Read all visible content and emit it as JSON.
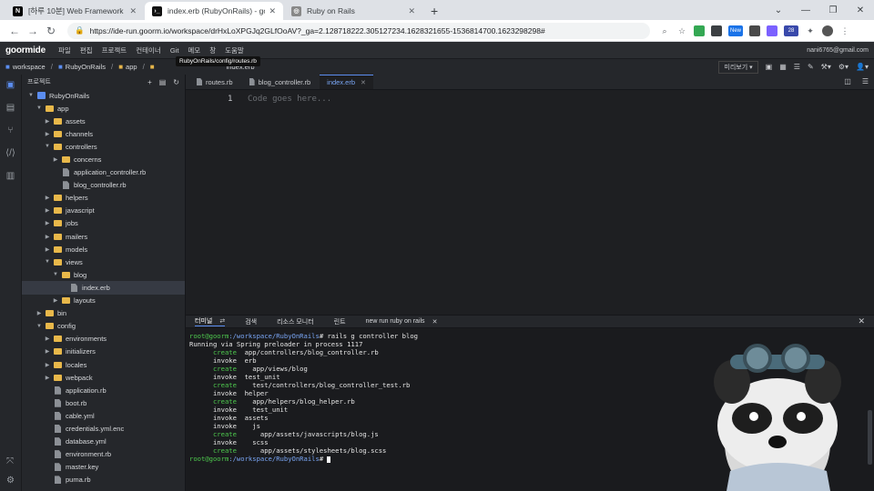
{
  "browser": {
    "tabs": [
      {
        "title": "[하루 10분] Web Framework : R",
        "favicon": "N",
        "favicon_color": "#000000",
        "active": false
      },
      {
        "title": "index.erb (RubyOnRails) - goorm",
        "favicon": "›_",
        "favicon_color": "#111111",
        "active": true
      },
      {
        "title": "Ruby on Rails",
        "favicon": "◎",
        "favicon_color": "#888888",
        "active": false
      }
    ],
    "new_tab": "+",
    "url": "https://ide-run.goorm.io/workspace/drHxLoXPGJq2GLfOoAV?_ga=2.128718222.305127234.1628321655-1536814700.1623298298#",
    "badge_new": "New",
    "badge_count": "28"
  },
  "ide": {
    "logo": "goormide",
    "menu": [
      "파일",
      "편집",
      "프로젝트",
      "컨테이너",
      "Git",
      "메모",
      "창",
      "도움말"
    ],
    "user": "nani6765@gmail.com",
    "breadcrumb": [
      "workspace",
      "RubyOnRails",
      "app",
      "",
      "index.erb"
    ],
    "tooltip": "RubyOnRails/config/routes.rb",
    "preview_label": "미리보기",
    "sidebar_title": "프로젝트",
    "tree": [
      {
        "label": "RubyOnRails",
        "type": "project",
        "depth": 0,
        "open": true
      },
      {
        "label": "app",
        "type": "folder",
        "depth": 1,
        "open": true
      },
      {
        "label": "assets",
        "type": "folder",
        "depth": 2,
        "open": false
      },
      {
        "label": "channels",
        "type": "folder",
        "depth": 2,
        "open": false
      },
      {
        "label": "controllers",
        "type": "folder",
        "depth": 2,
        "open": true
      },
      {
        "label": "concerns",
        "type": "folder",
        "depth": 3,
        "open": false
      },
      {
        "label": "application_controller.rb",
        "type": "file",
        "depth": 3
      },
      {
        "label": "blog_controller.rb",
        "type": "file",
        "depth": 3
      },
      {
        "label": "helpers",
        "type": "folder",
        "depth": 2,
        "open": false
      },
      {
        "label": "javascript",
        "type": "folder",
        "depth": 2,
        "open": false
      },
      {
        "label": "jobs",
        "type": "folder",
        "depth": 2,
        "open": false
      },
      {
        "label": "mailers",
        "type": "folder",
        "depth": 2,
        "open": false
      },
      {
        "label": "models",
        "type": "folder",
        "depth": 2,
        "open": false
      },
      {
        "label": "views",
        "type": "folder",
        "depth": 2,
        "open": true
      },
      {
        "label": "blog",
        "type": "folder",
        "depth": 3,
        "open": true
      },
      {
        "label": "index.erb",
        "type": "file",
        "depth": 4,
        "selected": true
      },
      {
        "label": "layouts",
        "type": "folder",
        "depth": 3,
        "open": false
      },
      {
        "label": "bin",
        "type": "folder",
        "depth": 1,
        "open": false
      },
      {
        "label": "config",
        "type": "folder",
        "depth": 1,
        "open": true
      },
      {
        "label": "environments",
        "type": "folder",
        "depth": 2,
        "open": false
      },
      {
        "label": "initializers",
        "type": "folder",
        "depth": 2,
        "open": false
      },
      {
        "label": "locales",
        "type": "folder",
        "depth": 2,
        "open": false
      },
      {
        "label": "webpack",
        "type": "folder",
        "depth": 2,
        "open": false
      },
      {
        "label": "application.rb",
        "type": "file",
        "depth": 2
      },
      {
        "label": "boot.rb",
        "type": "file",
        "depth": 2
      },
      {
        "label": "cable.yml",
        "type": "file",
        "depth": 2
      },
      {
        "label": "credentials.yml.enc",
        "type": "file",
        "depth": 2
      },
      {
        "label": "database.yml",
        "type": "file",
        "depth": 2
      },
      {
        "label": "environment.rb",
        "type": "file",
        "depth": 2
      },
      {
        "label": "master.key",
        "type": "file",
        "depth": 2
      },
      {
        "label": "puma.rb",
        "type": "file",
        "depth": 2
      }
    ],
    "editor_tabs": [
      {
        "label": "routes.rb",
        "active": false
      },
      {
        "label": "blog_controller.rb",
        "active": false
      },
      {
        "label": "index.erb",
        "active": true
      }
    ],
    "editor": {
      "line_number": "1",
      "placeholder": "Code goes here..."
    },
    "terminal_tabs": [
      {
        "label": "터미널",
        "active": true
      },
      {
        "label": "검색",
        "active": false
      },
      {
        "label": "리소스 모니터",
        "active": false
      },
      {
        "label": "린트",
        "active": false
      },
      {
        "label": "new run ruby on rails",
        "active": false
      }
    ],
    "terminal": {
      "prompt_user": "root@goorm",
      "prompt_path": ":/workspace/RubyOnRails",
      "command": "# rails g controller blog",
      "lines": [
        {
          "text": "Running via Spring preloader in process 1117",
          "action": "",
          "color": "plain"
        },
        {
          "action": "create",
          "text": "app/controllers/blog_controller.rb",
          "indent": "      "
        },
        {
          "action": "invoke",
          "text": "erb",
          "indent": "      "
        },
        {
          "action": "create",
          "text": "  app/views/blog",
          "indent": "      "
        },
        {
          "action": "invoke",
          "text": "test_unit",
          "indent": "      "
        },
        {
          "action": "create",
          "text": "  test/controllers/blog_controller_test.rb",
          "indent": "      "
        },
        {
          "action": "invoke",
          "text": "helper",
          "indent": "      "
        },
        {
          "action": "create",
          "text": "  app/helpers/blog_helper.rb",
          "indent": "      "
        },
        {
          "action": "invoke",
          "text": "  test_unit",
          "indent": "      "
        },
        {
          "action": "invoke",
          "text": "assets",
          "indent": "      "
        },
        {
          "action": "invoke",
          "text": "  js",
          "indent": "      "
        },
        {
          "action": "create",
          "text": "    app/assets/javascripts/blog.js",
          "indent": "      "
        },
        {
          "action": "invoke",
          "text": "  scss",
          "indent": "      "
        },
        {
          "action": "create",
          "text": "    app/assets/stylesheets/blog.scss",
          "indent": "      "
        }
      ],
      "final_prompt_suffix": "#"
    }
  },
  "colors": {
    "accent": "#5b8def",
    "create": "#4ec94e",
    "folder": "#e8b84a"
  }
}
